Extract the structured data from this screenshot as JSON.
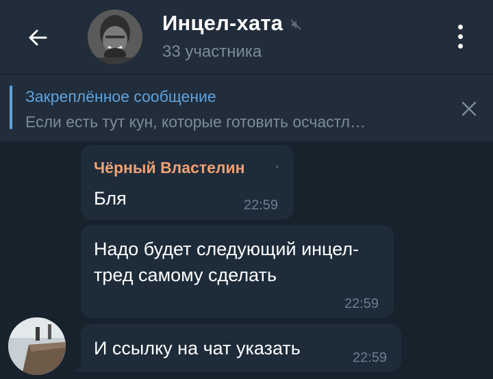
{
  "header": {
    "title": "Инцел-хата",
    "subtitle": "33 участника",
    "back_icon": "arrow-left-icon",
    "mute_icon": "muted-speaker-icon",
    "menu_icon": "vertical-dots-icon"
  },
  "pinned": {
    "title": "Закреплённое сообщение",
    "text": "Если есть тут кун, которые готовить осчастл…",
    "close_icon": "close-icon"
  },
  "messages": [
    {
      "sender": "Чёрный Властелин",
      "text": "Бля",
      "time": "22:59"
    },
    {
      "text": "Надо будет следующий инцел-тред самому сделать",
      "time": "22:59"
    },
    {
      "text": "И ссылку на чат указать",
      "time": "22:59"
    }
  ],
  "colors": {
    "background": "#18222d",
    "header": "#212d3b",
    "bubble": "#1e2c3a",
    "accent": "#5fa3de",
    "sender": "#f0a173",
    "muted_text": "#7d8b99"
  }
}
